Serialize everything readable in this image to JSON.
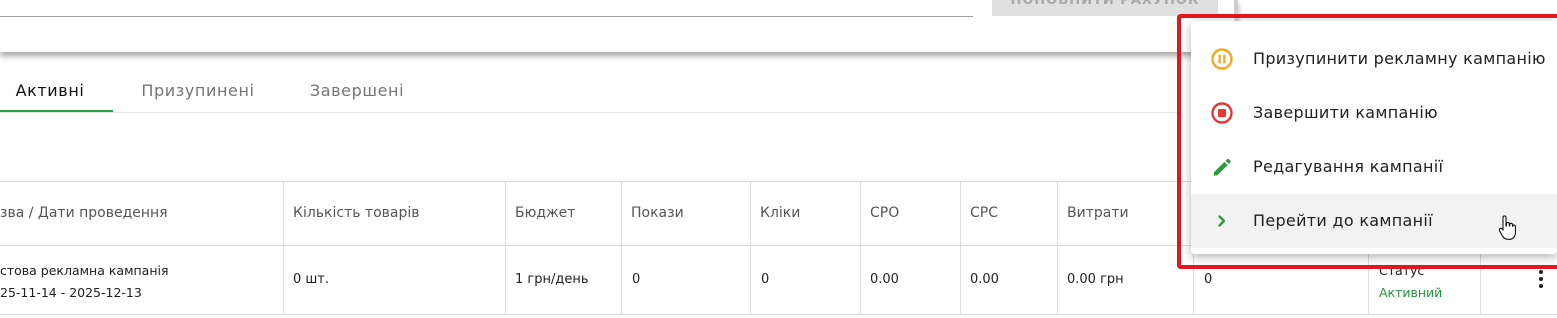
{
  "topbar": {
    "topup_label": "ПОПОВНИТИ РАХУНОК"
  },
  "tabs": [
    {
      "label": "Активні",
      "active": true
    },
    {
      "label": "Призупинені",
      "active": false
    },
    {
      "label": "Завершені",
      "active": false
    }
  ],
  "table": {
    "headers": [
      "зва / Дати проведення",
      "Кількість товарів",
      "Бюджет",
      "Покази",
      "Кліки",
      "CPO",
      "CPC",
      "Витрати"
    ],
    "row": {
      "name": "стова рекламна кампанія",
      "dates": "25-11-14 - 2025-12-13",
      "products": "0 шт.",
      "budget": "1 грн/день",
      "impressions": "0",
      "clicks": "0",
      "cpo": "0.00",
      "cpc": "0.00",
      "spend": "0.00 грн",
      "extra": "0",
      "status_label": "Статус",
      "status_value": "Активний"
    }
  },
  "menu": {
    "items": [
      {
        "label": "Призупинити рекламну кампанію",
        "icon": "pause-circle-icon",
        "color": "#f5a623"
      },
      {
        "label": "Завершити кампанію",
        "icon": "stop-circle-icon",
        "color": "#e53935"
      },
      {
        "label": "Редагування кампанії",
        "icon": "pencil-icon",
        "color": "#2e9a40"
      },
      {
        "label": "Перейти до кампанії",
        "icon": "chevron-right-icon",
        "color": "#2e9a40"
      }
    ]
  },
  "colors": {
    "accent": "#2e9a40",
    "highlight": "#e2161c",
    "status_active": "#1f9a3a"
  }
}
